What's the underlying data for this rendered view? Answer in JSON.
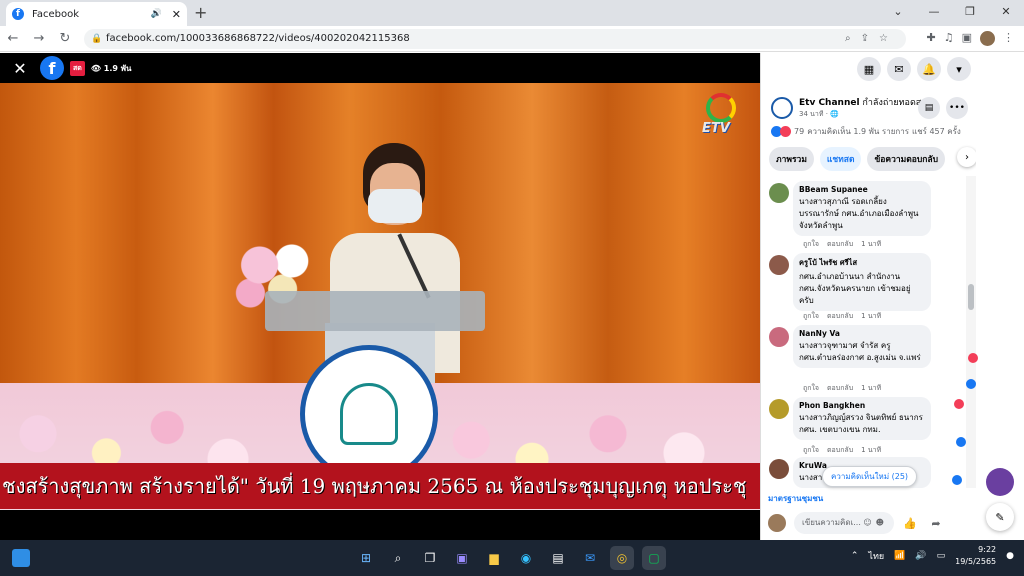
{
  "browser": {
    "tab_title": "Facebook",
    "url": "facebook.com/100033686868722/videos/400202042115368",
    "new_tab": "+",
    "audio_icon": "speaker-icon",
    "tab_close": "✕",
    "window_buttons": [
      "⌄",
      "—",
      "❐",
      "✕"
    ]
  },
  "video": {
    "close": "✕",
    "live_badge": "สด",
    "views": "1.9 พัน",
    "ticker": "ชงสร้างสุขภาพ สร้างรายได้\" วันที่ 19 พฤษภาคม 2565 ณ ห้องประชุมบุญเกตุ หอประชุ"
  },
  "page": {
    "name": "Etv Channel",
    "status": "กำลังถ่ายทอดสด",
    "time": "34 นาที · 🌐",
    "reactions": "79",
    "comments": "ความคิดเห็น 1.9 พัน รายการ",
    "shares": "แชร์ 457 ครั้ง"
  },
  "tabs": [
    "ภาพรวม",
    "แชทสด",
    "ข้อความตอบกลับ"
  ],
  "comments": [
    {
      "name": "BBeam Supanee",
      "text": "นางสาวสุภาณี รอดเกลี้ยง บรรณารักษ์ กศน.อำเภอเมืองลำพูน จังหวัดลำพูน",
      "color": "#6b8e4e"
    },
    {
      "name": "ครูโบ้ ไพรัช ศรีไส",
      "text": "กศน.อำเภอบ้านนา สำนักงาน กศน.จังหวัดนครนายก เข้าชมอยู่ครับ",
      "color": "#8c5a4a"
    },
    {
      "name": "NanNy Va",
      "text": "นางสาวจุฑามาศ จำรัส ครู กศน.ตำบลร่องกาศ อ.สูงเม่น จ.แพร่",
      "color": "#c96a7e"
    },
    {
      "name": "Phon Bangkhen",
      "text": "นางสาวภิญญ์สรวง จินตทิพย์ ธนากร กศน. เขตบางเขน กทม.",
      "color": "#b59b2a"
    },
    {
      "name": "KruWa",
      "text": "นางสาว...",
      "color": "#7a4d3a"
    }
  ],
  "comment_actions": {
    "like": "ถูกใจ",
    "reply": "ตอบกลับ",
    "time": "1 นาที"
  },
  "new_comments": "ความคิดเห็นใหม่ (25)",
  "standards": "มาตรฐานชุมชน",
  "input_placeholder": "เขียนความคิดเ...",
  "taskbar": {
    "lang": "ไทย",
    "time": "9:22",
    "date": "19/5/2565"
  },
  "colors": {
    "facebook_blue": "#1877f2",
    "ticker_red": "#b3121d",
    "taskbar": "#1b2533"
  }
}
